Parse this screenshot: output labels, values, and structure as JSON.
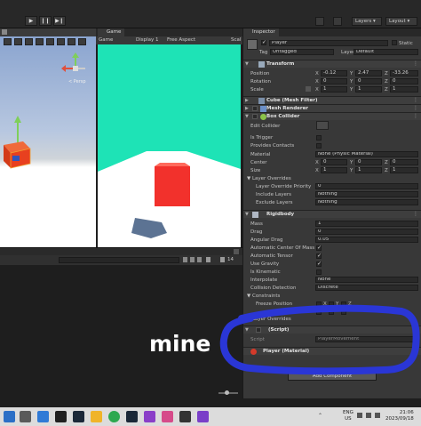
{
  "toolbar": {
    "layers_label": "Layers",
    "layout_label": "Layout",
    "play_icons": [
      "play-icon",
      "pause-icon",
      "step-icon"
    ]
  },
  "game_view": {
    "tab_label": "Game",
    "mode": "Game",
    "display": "Display 1",
    "aspect": "Free Aspect",
    "scale_label": "Scal"
  },
  "scene_view": {
    "persp_label": "< Persp"
  },
  "console": {
    "counter": "14"
  },
  "inspector": {
    "tab_label": "Inspector",
    "object_name": "Player",
    "static_label": "Static",
    "tag_label": "Tag",
    "tag_value": "Untagged",
    "layer_label": "Layer",
    "layer_value": "Default",
    "transform": {
      "title": "Transform",
      "position_label": "Position",
      "rotation_label": "Rotation",
      "scale_label": "Scale",
      "position": {
        "x": "-0.12",
        "y": "2.47",
        "z": "-33.26"
      },
      "rotation": {
        "x": "0",
        "y": "0",
        "z": "0"
      },
      "scale": {
        "x": "1",
        "y": "1",
        "z": "1"
      }
    },
    "mesh_filter_title": "Cube (Mesh Filter)",
    "mesh_renderer_title": "Mesh Renderer",
    "box_collider": {
      "title": "Box Collider",
      "edit_collider": "Edit Collider",
      "is_trigger": "Is Trigger",
      "provides_contacts": "Provides Contacts",
      "material_label": "Material",
      "material_value": "None (Physic Material)",
      "center_label": "Center",
      "center": {
        "x": "0",
        "y": "0",
        "z": "0"
      },
      "size_label": "Size",
      "size": {
        "x": "1",
        "y": "1",
        "z": "1"
      },
      "layer_overrides": "Layer Overrides",
      "layer_override_priority": "Layer Override Priority",
      "layer_override_priority_value": "0",
      "include_layers": "Include Layers",
      "include_layers_value": "Nothing",
      "exclude_layers": "Exclude Layers",
      "exclude_layers_value": "Nothing"
    },
    "rigidbody": {
      "title": "Rigidbody",
      "mass_label": "Mass",
      "mass": "1",
      "drag_label": "Drag",
      "drag": "0",
      "angular_drag_label": "Angular Drag",
      "angular_drag": "0.05",
      "auto_center_label": "Automatic Center Of Mass",
      "auto_tensor_label": "Automatic Tensor",
      "use_gravity_label": "Use Gravity",
      "is_kinematic_label": "Is Kinematic",
      "interpolate_label": "Interpolate",
      "interpolate_value": "None",
      "collision_label": "Collision Detection",
      "collision_value": "Discrete",
      "constraints_label": "Constraints",
      "freeze_position_label": "Freeze Position",
      "freeze_rotation_label": "Rotation",
      "layer_overrides": "Layer Overrides"
    },
    "script_component": {
      "title": "(Script)",
      "script_label": "Script",
      "script_value": "PlayerMovement"
    },
    "material_component": {
      "title": "Player (Material)"
    },
    "add_component": "Add Component"
  },
  "overlay": {
    "handwritten_text": "mine",
    "circle_color": "#2a36d6"
  },
  "taskbar": {
    "lang_top": "ENG",
    "lang_bottom": "US",
    "time": "21:06",
    "date": "2023/09/18"
  },
  "colors": {
    "game_sky": "#1ee3b6",
    "cube_red": "#f2312c",
    "scene_cube": "#e8401f",
    "ground": "#ffffff",
    "panel_bg": "#383838"
  }
}
